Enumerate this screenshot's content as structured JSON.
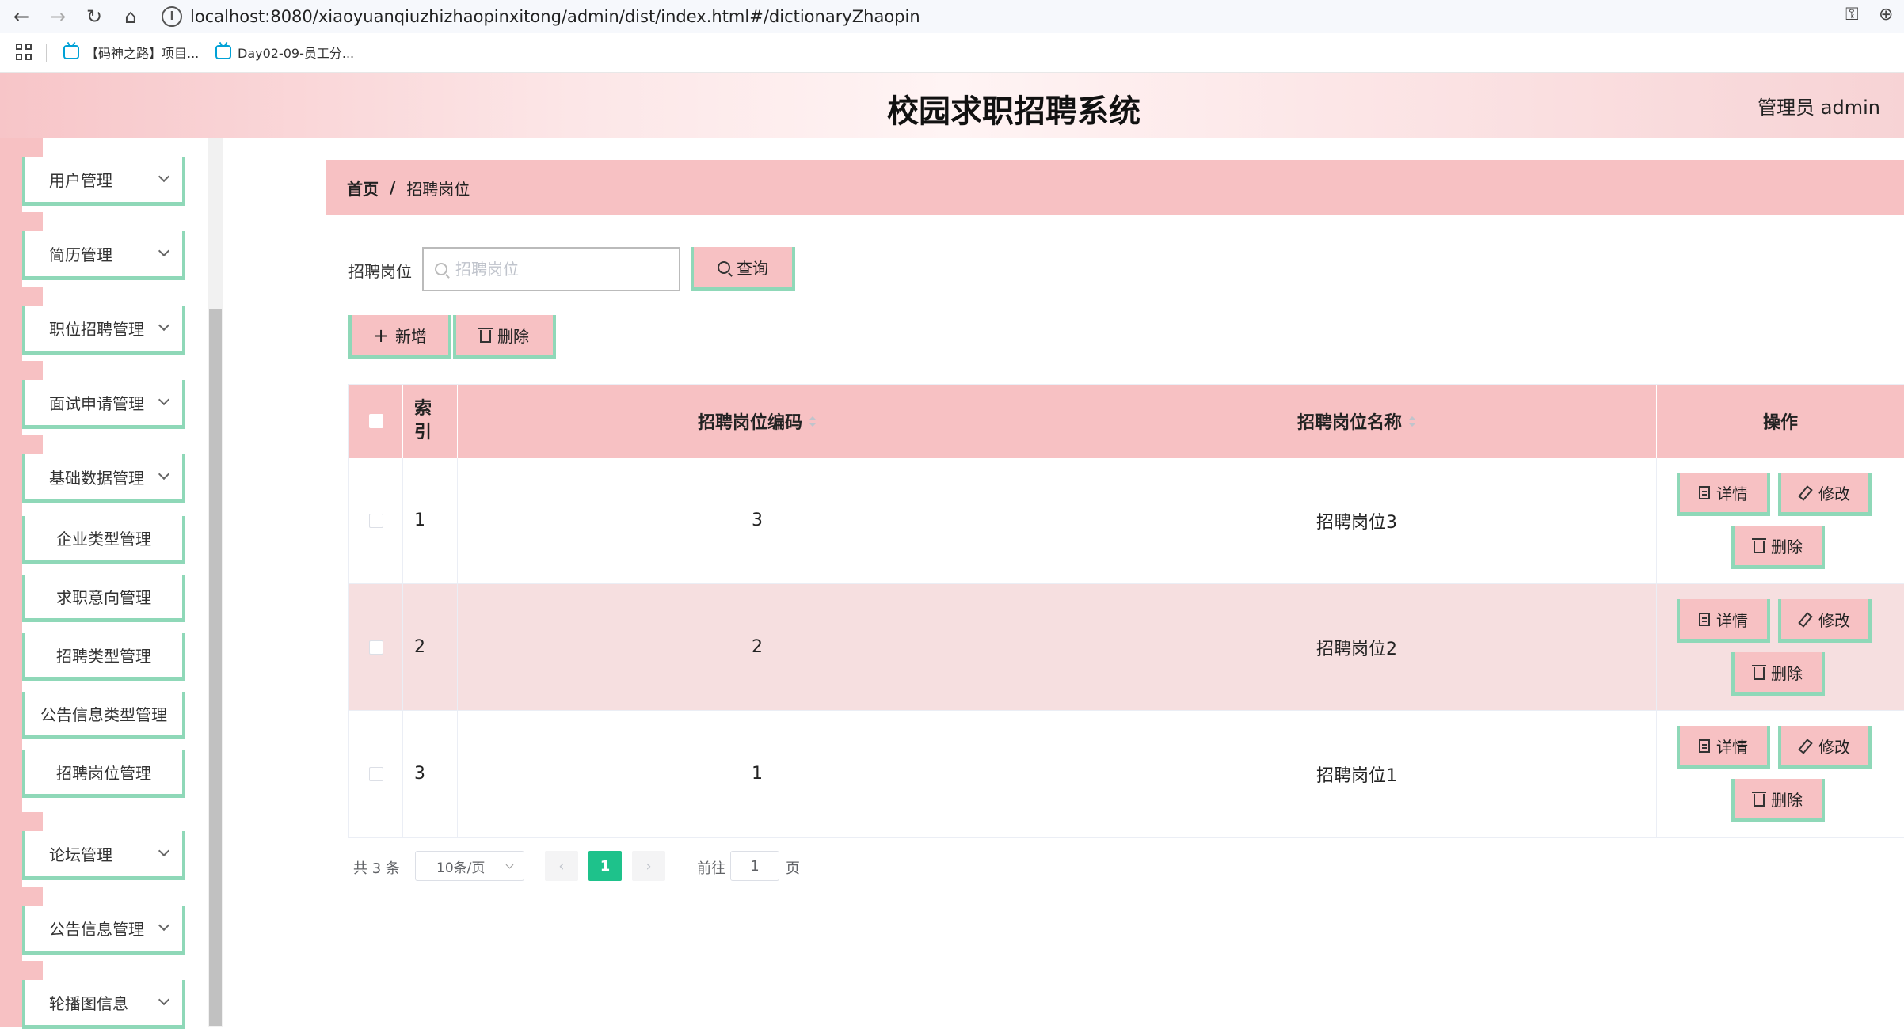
{
  "browser": {
    "url": "localhost:8080/xiaoyuanqiuzhizhaopinxitong/admin/dist/index.html#/dictionaryZhaopin",
    "bookmarks": [
      "【码神之路】项目...",
      "Day02-09-员工分..."
    ]
  },
  "header": {
    "title": "校园求职招聘系统",
    "user": "管理员 admin"
  },
  "sidebar": {
    "items": [
      {
        "label": "用户管理"
      },
      {
        "label": "简历管理"
      },
      {
        "label": "职位招聘管理"
      },
      {
        "label": "面试申请管理"
      },
      {
        "label": "基础数据管理"
      },
      {
        "label": "论坛管理"
      },
      {
        "label": "公告信息管理"
      },
      {
        "label": "轮播图信息"
      }
    ],
    "sub_items": [
      {
        "label": "企业类型管理"
      },
      {
        "label": "求职意向管理"
      },
      {
        "label": "招聘类型管理"
      },
      {
        "label": "公告信息类型管理"
      },
      {
        "label": "招聘岗位管理"
      }
    ]
  },
  "breadcrumb": {
    "home": "首页",
    "separator": "/",
    "current": "招聘岗位"
  },
  "search": {
    "label": "招聘岗位",
    "placeholder": "招聘岗位",
    "value": "",
    "button": "查询"
  },
  "toolbar": {
    "add": "新增",
    "delete": "删除"
  },
  "table": {
    "columns": {
      "index": "索\n引",
      "code": "招聘岗位编码",
      "name": "招聘岗位名称",
      "ops": "操作"
    },
    "rows": [
      {
        "index": "1",
        "code": "3",
        "name": "招聘岗位3"
      },
      {
        "index": "2",
        "code": "2",
        "name": "招聘岗位2"
      },
      {
        "index": "3",
        "code": "1",
        "name": "招聘岗位1"
      }
    ],
    "row_actions": {
      "detail": "详情",
      "edit": "修改",
      "delete": "删除"
    }
  },
  "pagination": {
    "total": "共 3 条",
    "page_size": "10条/页",
    "current_page": "1",
    "goto_label": "前往",
    "goto_value": "1",
    "page_suffix": "页",
    "prev": "‹",
    "next": "›"
  },
  "colors": {
    "pink": "#f7c1c3",
    "mint": "#8fd8b8",
    "active_page": "#1ec28b",
    "row_alt": "#f6dfe0"
  },
  "icons": [
    "back-icon",
    "forward-icon",
    "reload-icon",
    "home-icon",
    "site-info-icon",
    "key-icon",
    "zoom-icon",
    "apps-icon",
    "bilibili-icon",
    "chevron-down-icon",
    "search-icon",
    "plus-icon",
    "trash-icon",
    "document-icon",
    "edit-icon"
  ]
}
